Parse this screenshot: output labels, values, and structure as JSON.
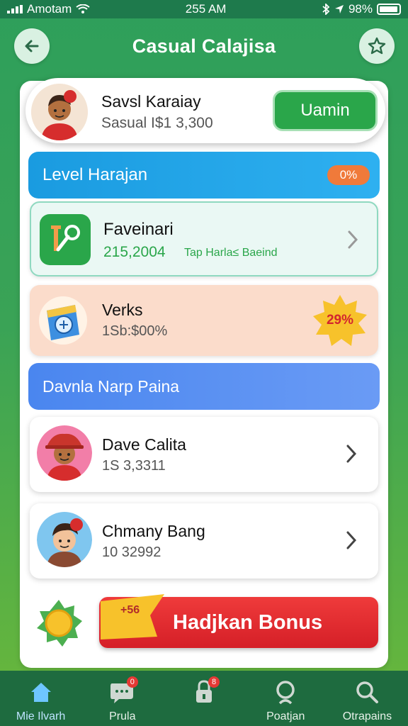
{
  "status_bar": {
    "carrier": "Amotam",
    "time": "255 AM",
    "battery": "98%",
    "battery_level": 0.98
  },
  "header": {
    "title": "Casual Calajisa",
    "back_icon": "arrow-left-icon",
    "right_icon": "star-badge-icon"
  },
  "profile": {
    "name": "Savsl Karaiay",
    "subtitle": "Sasual I$1 3,300",
    "action_label": "Uamin"
  },
  "level_bar": {
    "label": "Level Harajan",
    "badge": "0%"
  },
  "favorite_card": {
    "title": "Faveinari",
    "value": "215,2004",
    "tag": "Tap Harla≤ Baeind",
    "icon": "pin-key-icon"
  },
  "verks_card": {
    "title": "Verks",
    "subtitle": "1Sb:$00%",
    "badge": "29%",
    "icon": "washing-machine-icon"
  },
  "section_bar": {
    "label": "Davnla Narp Paina"
  },
  "users": [
    {
      "name": "Dave Calita",
      "subtitle": "1S 3,3311"
    },
    {
      "name": "Chmany Bang",
      "subtitle": "10 32992"
    }
  ],
  "bonus": {
    "flag_text": "+56",
    "label": "Hadjkan Bonus",
    "icon": "sun-badge-icon"
  },
  "bottom_nav": [
    {
      "label": "Mie Ilvarh",
      "icon": "home-icon",
      "badge": ""
    },
    {
      "label": "Prula",
      "icon": "chat-icon",
      "badge": "0"
    },
    {
      "label": "",
      "icon": "lock-icon",
      "badge": "8"
    },
    {
      "label": "Poatjan",
      "icon": "magnifier-icon",
      "badge": ""
    },
    {
      "label": "Otrapains",
      "icon": "search-icon",
      "badge": ""
    }
  ],
  "colors": {
    "primary_green": "#2aa64a",
    "header_green": "#2e9f5b",
    "level_blue": "#1a9be0",
    "section_blue": "#4a86ef",
    "bonus_red": "#d51f27",
    "badge_orange": "#f07a3a"
  }
}
